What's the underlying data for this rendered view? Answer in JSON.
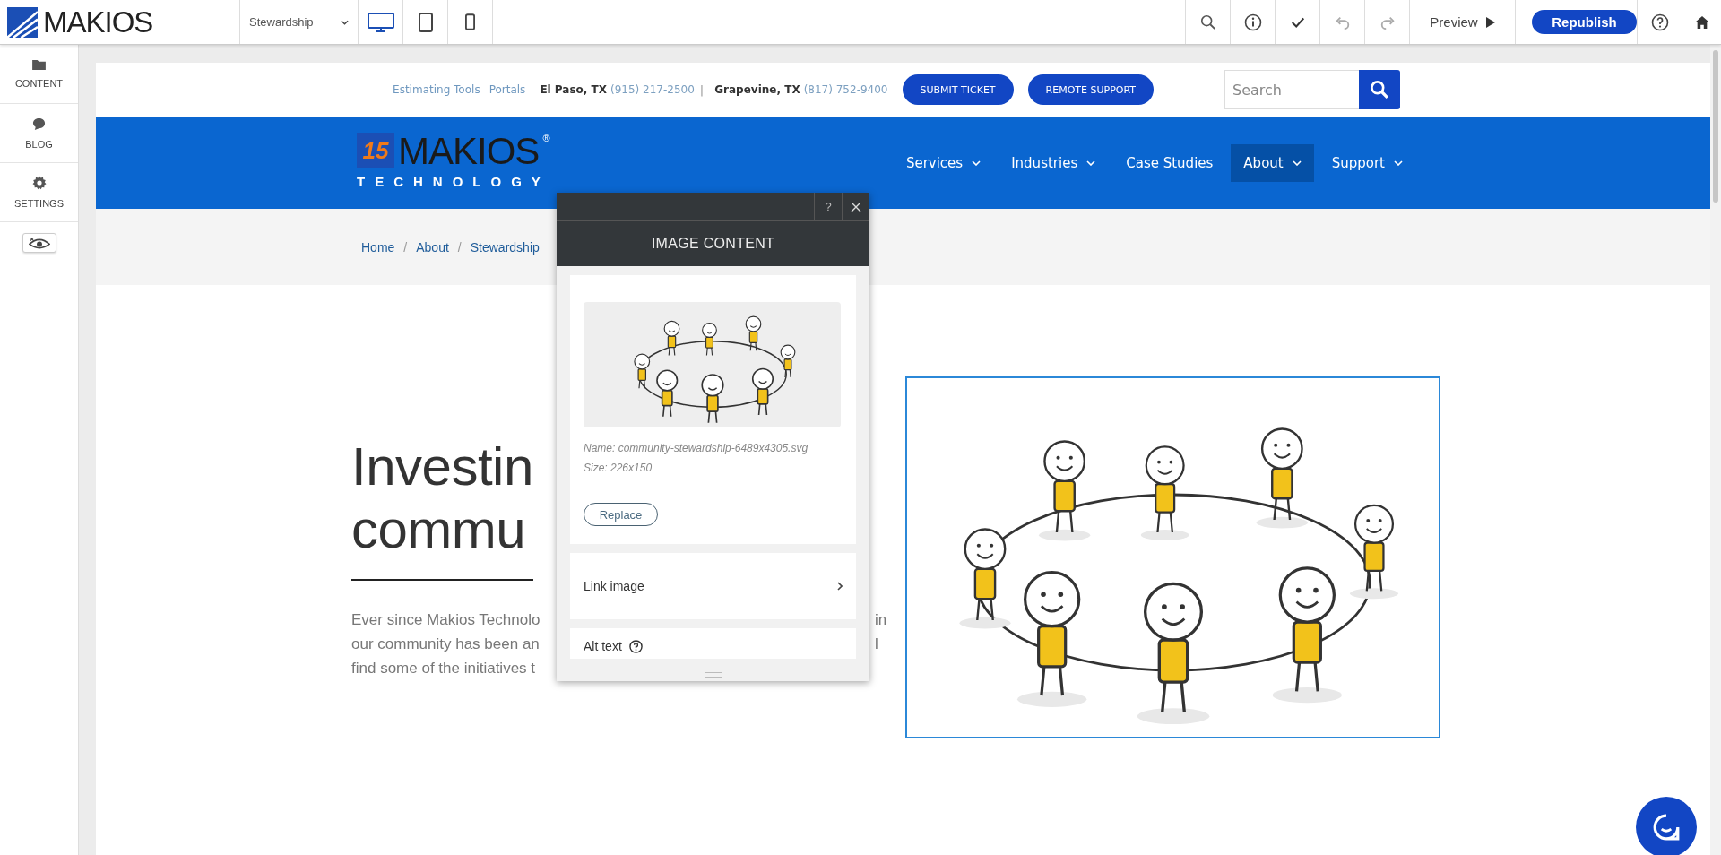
{
  "toolbar": {
    "logo": "MAKIOS",
    "page_select": "Stewardship",
    "devices": [
      {
        "kind": "desktop",
        "selected": true
      },
      {
        "kind": "tablet",
        "selected": false
      },
      {
        "kind": "phone",
        "selected": false
      }
    ],
    "preview": "Preview",
    "republish": "Republish"
  },
  "sidebar": {
    "items": [
      {
        "kind": "content",
        "label": "CONTENT"
      },
      {
        "kind": "blog",
        "label": "BLOG"
      },
      {
        "kind": "settings",
        "label": "SETTINGS"
      }
    ]
  },
  "site": {
    "top_links": [
      "Estimating Tools",
      "Portals"
    ],
    "locations": [
      {
        "city": "El Paso, TX",
        "phone": "(915) 217-2500"
      },
      {
        "city": "Grapevine, TX",
        "phone": "(817) 752-9400"
      }
    ],
    "location_separator": "|",
    "buttons": [
      "SUBMIT TICKET",
      "REMOTE SUPPORT"
    ],
    "search": {
      "placeholder": "Search"
    },
    "logo": {
      "badge": "15",
      "name": "MAKIOS",
      "registered": "®",
      "tagline": "TECHNOLOGY"
    },
    "nav": [
      {
        "label": "Services",
        "dropdown": true,
        "selected": false
      },
      {
        "label": "Industries",
        "dropdown": true,
        "selected": false
      },
      {
        "label": "Case Studies",
        "dropdown": false,
        "selected": false
      },
      {
        "label": "About",
        "dropdown": true,
        "selected": true
      },
      {
        "label": "Support",
        "dropdown": true,
        "selected": false
      }
    ],
    "breadcrumb": [
      "Home",
      "About",
      "Stewardship"
    ],
    "breadcrumb_separator": "/",
    "heading_lines": [
      "Investin",
      "commu"
    ],
    "paragraph_lines": [
      {
        "left": "Ever since Makios Technolo",
        "right": "in"
      },
      {
        "left": "our community has been an",
        "right": "l"
      },
      {
        "left": "find some of the initiatives t"
      }
    ]
  },
  "dialog": {
    "help": "?",
    "title": "IMAGE CONTENT",
    "file_name": "Name: community-stewardship-6489x4305.svg",
    "file_size": "Size: 226x150",
    "replace": "Replace",
    "link_image": "Link image",
    "alt_text": "Alt text"
  }
}
